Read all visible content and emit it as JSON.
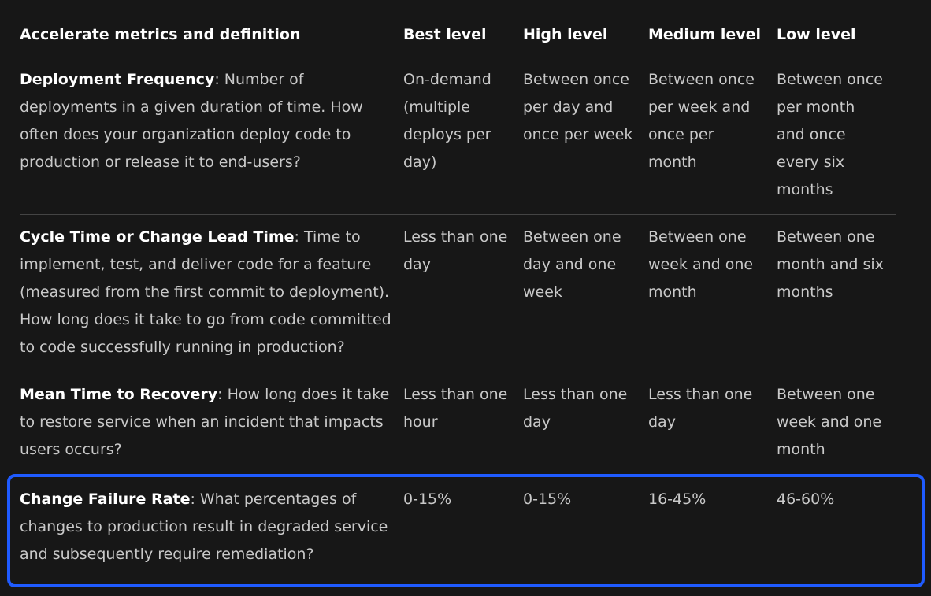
{
  "table": {
    "headers": [
      "Accelerate metrics and definition",
      "Best level",
      "High level",
      "Medium level",
      "Low level"
    ],
    "rows": [
      {
        "name": "Deployment Frequency",
        "definition": ": Number of deployments in a given duration of time. How often does your organization deploy code to production or release it to end-users?",
        "best": "On-demand (multiple deploys per day)",
        "high": "Between once per day and once per week",
        "medium": "Between once per week and once per month",
        "low": "Between once per month and once every six months"
      },
      {
        "name": "Cycle Time or Change Lead Time",
        "definition": ": Time to implement, test, and deliver code for a feature (measured from the first commit to deployment). How long does it take to go from code committed to code successfully running in production?",
        "best": "Less than one day",
        "high": "Between one day and one week",
        "medium": "Between one week and one month",
        "low": "Between one month and six months"
      },
      {
        "name": "Mean Time to Recovery",
        "definition": ": How long does it take to restore service when an incident that impacts users occurs?",
        "best": "Less than one hour",
        "high": "Less than one day",
        "medium": "Less than one day",
        "low": "Between one week and one month"
      },
      {
        "name": "Change Failure Rate",
        "definition": ": What percentages of changes to production result in degraded service and subsequently require remediation?",
        "best": "0-15%",
        "high": "0-15%",
        "medium": "16-45%",
        "low": "46-60%"
      }
    ]
  },
  "highlight": {
    "color": "#1f5bff",
    "highlighted_row": "Change Failure Rate"
  }
}
